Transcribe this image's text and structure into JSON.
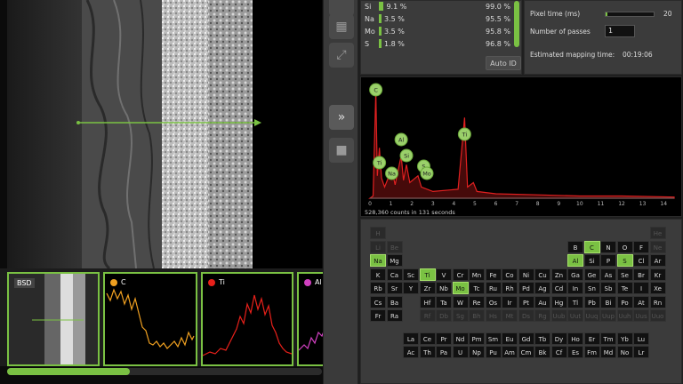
{
  "thumbnails": [
    {
      "label": "BSD",
      "color": ""
    },
    {
      "label": "C",
      "color": "#f0a020"
    },
    {
      "label": "Ti",
      "color": "#e8201a"
    },
    {
      "label": "Al",
      "color": "#d040c0"
    }
  ],
  "progress": {
    "fraction": 0.39
  },
  "quant": {
    "rows": [
      {
        "el": "Si",
        "pct": "9.1 %",
        "total": "99.0 %",
        "frac": 0.091
      },
      {
        "el": "Na",
        "pct": "3.5 %",
        "total": "95.5 %",
        "frac": 0.035
      },
      {
        "el": "Mo",
        "pct": "3.5 %",
        "total": "95.8 %",
        "frac": 0.035
      },
      {
        "el": "S",
        "pct": "1.8 %",
        "total": "96.8 %",
        "frac": 0.018
      }
    ],
    "auto_id": "Auto ID"
  },
  "settings": {
    "pixel_time_label": "Pixel time (ms)",
    "pixel_time_value": "20",
    "pixel_time_frac": 0.04,
    "passes_label": "Number of passes",
    "passes_value": "1",
    "est_label": "Estimated mapping time:",
    "est_value": "00:19:06"
  },
  "spectrum": {
    "counts_text": "528,360 counts in 131 seconds",
    "x_ticks": [
      "0",
      "1",
      "2",
      "3",
      "4",
      "5",
      "6",
      "7",
      "8",
      "9",
      "10",
      "11",
      "12",
      "13",
      "14"
    ],
    "peaks": [
      {
        "el": "C",
        "x": 0.28
      },
      {
        "el": "Ti",
        "x": 0.45
      },
      {
        "el": "Na",
        "x": 1.04
      },
      {
        "el": "Al",
        "x": 1.49
      },
      {
        "el": "Si",
        "x": 1.74
      },
      {
        "el": "S",
        "x": 2.31
      },
      {
        "el": "Mo",
        "x": 2.29
      },
      {
        "el": "Ti",
        "x": 4.51
      }
    ]
  },
  "periodic": {
    "main": [
      {
        "s": "H",
        "r": 0,
        "c": 0,
        "d": 1
      },
      {
        "s": "He",
        "r": 0,
        "c": 17,
        "d": 1
      },
      {
        "s": "Li",
        "r": 1,
        "c": 0,
        "d": 1
      },
      {
        "s": "Be",
        "r": 1,
        "c": 1,
        "d": 1
      },
      {
        "s": "B",
        "r": 1,
        "c": 12
      },
      {
        "s": "C",
        "r": 1,
        "c": 13,
        "on": 1
      },
      {
        "s": "N",
        "r": 1,
        "c": 14
      },
      {
        "s": "O",
        "r": 1,
        "c": 15
      },
      {
        "s": "F",
        "r": 1,
        "c": 16
      },
      {
        "s": "Ne",
        "r": 1,
        "c": 17,
        "d": 1
      },
      {
        "s": "Na",
        "r": 2,
        "c": 0,
        "on": 1
      },
      {
        "s": "Mg",
        "r": 2,
        "c": 1
      },
      {
        "s": "Al",
        "r": 2,
        "c": 12,
        "on": 1
      },
      {
        "s": "Si",
        "r": 2,
        "c": 13
      },
      {
        "s": "P",
        "r": 2,
        "c": 14
      },
      {
        "s": "S",
        "r": 2,
        "c": 15,
        "on": 1
      },
      {
        "s": "Cl",
        "r": 2,
        "c": 16
      },
      {
        "s": "Ar",
        "r": 2,
        "c": 17
      },
      {
        "s": "K",
        "r": 3,
        "c": 0
      },
      {
        "s": "Ca",
        "r": 3,
        "c": 1
      },
      {
        "s": "Sc",
        "r": 3,
        "c": 2
      },
      {
        "s": "Ti",
        "r": 3,
        "c": 3,
        "on": 1
      },
      {
        "s": "V",
        "r": 3,
        "c": 4
      },
      {
        "s": "Cr",
        "r": 3,
        "c": 5
      },
      {
        "s": "Mn",
        "r": 3,
        "c": 6
      },
      {
        "s": "Fe",
        "r": 3,
        "c": 7
      },
      {
        "s": "Co",
        "r": 3,
        "c": 8
      },
      {
        "s": "Ni",
        "r": 3,
        "c": 9
      },
      {
        "s": "Cu",
        "r": 3,
        "c": 10
      },
      {
        "s": "Zn",
        "r": 3,
        "c": 11
      },
      {
        "s": "Ga",
        "r": 3,
        "c": 12
      },
      {
        "s": "Ge",
        "r": 3,
        "c": 13
      },
      {
        "s": "As",
        "r": 3,
        "c": 14
      },
      {
        "s": "Se",
        "r": 3,
        "c": 15
      },
      {
        "s": "Br",
        "r": 3,
        "c": 16
      },
      {
        "s": "Kr",
        "r": 3,
        "c": 17
      },
      {
        "s": "Rb",
        "r": 4,
        "c": 0
      },
      {
        "s": "Sr",
        "r": 4,
        "c": 1
      },
      {
        "s": "Y",
        "r": 4,
        "c": 2
      },
      {
        "s": "Zr",
        "r": 4,
        "c": 3
      },
      {
        "s": "Nb",
        "r": 4,
        "c": 4
      },
      {
        "s": "Mo",
        "r": 4,
        "c": 5,
        "on": 1
      },
      {
        "s": "Tc",
        "r": 4,
        "c": 6
      },
      {
        "s": "Ru",
        "r": 4,
        "c": 7
      },
      {
        "s": "Rh",
        "r": 4,
        "c": 8
      },
      {
        "s": "Pd",
        "r": 4,
        "c": 9
      },
      {
        "s": "Ag",
        "r": 4,
        "c": 10
      },
      {
        "s": "Cd",
        "r": 4,
        "c": 11
      },
      {
        "s": "In",
        "r": 4,
        "c": 12
      },
      {
        "s": "Sn",
        "r": 4,
        "c": 13
      },
      {
        "s": "Sb",
        "r": 4,
        "c": 14
      },
      {
        "s": "Te",
        "r": 4,
        "c": 15
      },
      {
        "s": "I",
        "r": 4,
        "c": 16
      },
      {
        "s": "Xe",
        "r": 4,
        "c": 17
      },
      {
        "s": "Cs",
        "r": 5,
        "c": 0
      },
      {
        "s": "Ba",
        "r": 5,
        "c": 1
      },
      {
        "s": "Hf",
        "r": 5,
        "c": 3
      },
      {
        "s": "Ta",
        "r": 5,
        "c": 4
      },
      {
        "s": "W",
        "r": 5,
        "c": 5
      },
      {
        "s": "Re",
        "r": 5,
        "c": 6
      },
      {
        "s": "Os",
        "r": 5,
        "c": 7
      },
      {
        "s": "Ir",
        "r": 5,
        "c": 8
      },
      {
        "s": "Pt",
        "r": 5,
        "c": 9
      },
      {
        "s": "Au",
        "r": 5,
        "c": 10
      },
      {
        "s": "Hg",
        "r": 5,
        "c": 11
      },
      {
        "s": "Tl",
        "r": 5,
        "c": 12
      },
      {
        "s": "Pb",
        "r": 5,
        "c": 13
      },
      {
        "s": "Bi",
        "r": 5,
        "c": 14
      },
      {
        "s": "Po",
        "r": 5,
        "c": 15
      },
      {
        "s": "At",
        "r": 5,
        "c": 16
      },
      {
        "s": "Rn",
        "r": 5,
        "c": 17
      },
      {
        "s": "Fr",
        "r": 6,
        "c": 0
      },
      {
        "s": "Ra",
        "r": 6,
        "c": 1
      },
      {
        "s": "Rf",
        "r": 6,
        "c": 3,
        "d": 1
      },
      {
        "s": "Db",
        "r": 6,
        "c": 4,
        "d": 1
      },
      {
        "s": "Sg",
        "r": 6,
        "c": 5,
        "d": 1
      },
      {
        "s": "Bh",
        "r": 6,
        "c": 6,
        "d": 1
      },
      {
        "s": "Hs",
        "r": 6,
        "c": 7,
        "d": 1
      },
      {
        "s": "Mt",
        "r": 6,
        "c": 8,
        "d": 1
      },
      {
        "s": "Ds",
        "r": 6,
        "c": 9,
        "d": 1
      },
      {
        "s": "Rg",
        "r": 6,
        "c": 10,
        "d": 1
      },
      {
        "s": "Uub",
        "r": 6,
        "c": 11,
        "d": 1
      },
      {
        "s": "Uut",
        "r": 6,
        "c": 12,
        "d": 1
      },
      {
        "s": "Uuq",
        "r": 6,
        "c": 13,
        "d": 1
      },
      {
        "s": "Uup",
        "r": 6,
        "c": 14,
        "d": 1
      },
      {
        "s": "Uuh",
        "r": 6,
        "c": 15,
        "d": 1
      },
      {
        "s": "Uus",
        "r": 6,
        "c": 16,
        "d": 1
      },
      {
        "s": "Uuo",
        "r": 6,
        "c": 17,
        "d": 1
      }
    ],
    "lanth": [
      "La",
      "Ce",
      "Pr",
      "Nd",
      "Pm",
      "Sm",
      "Eu",
      "Gd",
      "Tb",
      "Dy",
      "Ho",
      "Er",
      "Tm",
      "Yb",
      "Lu"
    ],
    "act": [
      "Ac",
      "Th",
      "Pa",
      "U",
      "Np",
      "Pu",
      "Am",
      "Cm",
      "Bk",
      "Cf",
      "Es",
      "Fm",
      "Md",
      "No",
      "Lr"
    ]
  }
}
